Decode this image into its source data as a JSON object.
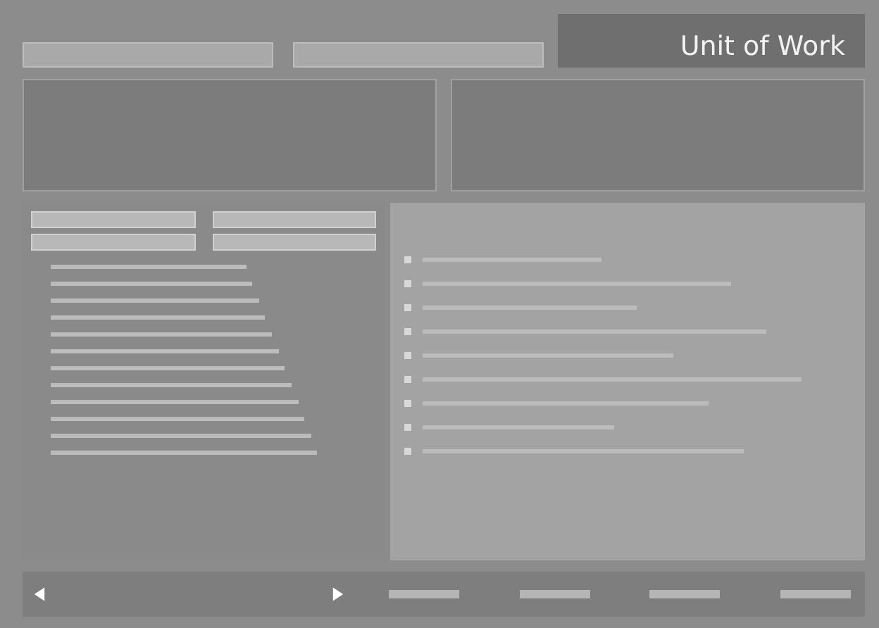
{
  "header": {
    "title": "Unit of Work"
  }
}
